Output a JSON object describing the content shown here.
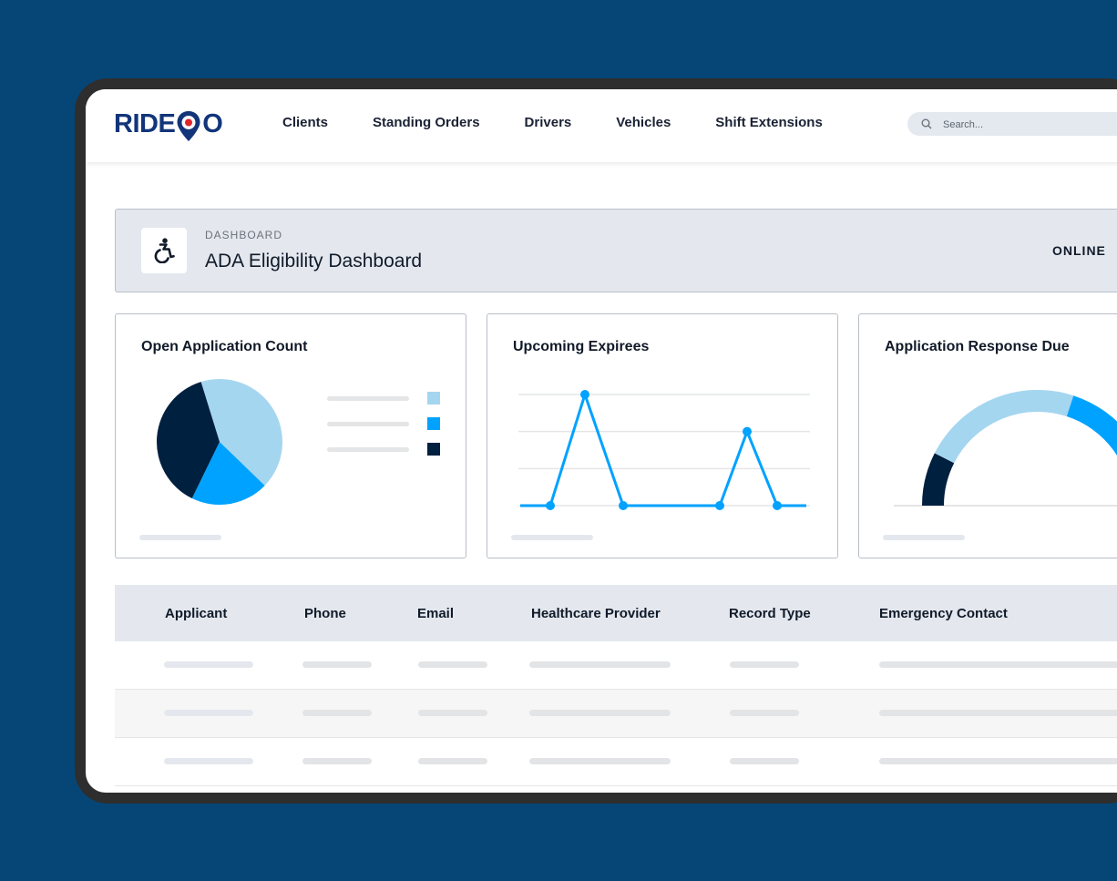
{
  "app": {
    "logo_text_left": "RIDE",
    "logo_text_right": "O"
  },
  "nav": {
    "links": [
      "Clients",
      "Standing Orders",
      "Drivers",
      "Vehicles",
      "Shift Extensions"
    ],
    "search_placeholder": "Search..."
  },
  "header": {
    "kicker": "DASHBOARD",
    "title": "ADA Eligibility Dashboard",
    "status": "ONLINE"
  },
  "cards": {
    "open_applications": {
      "title": "Open Application Count"
    },
    "upcoming_expirees": {
      "title": "Upcoming Expirees"
    },
    "response_due": {
      "title": "Application Response Due"
    }
  },
  "chart_data": [
    {
      "type": "pie",
      "slices": [
        {
          "value": 42,
          "color": "#a5d6f0"
        },
        {
          "value": 20,
          "color": "#00a2ff"
        },
        {
          "value": 38,
          "color": "#00203f"
        }
      ]
    },
    {
      "type": "line",
      "x": [
        1,
        2,
        3,
        4,
        5,
        6,
        7,
        8
      ],
      "values": [
        0,
        0,
        3,
        0,
        0,
        2,
        0,
        0
      ],
      "markers": [
        false,
        true,
        true,
        true,
        true,
        true,
        true,
        false
      ],
      "ylim": [
        0,
        3
      ],
      "grid": true,
      "color": "#00a2ff"
    },
    {
      "type": "gauge",
      "segments": [
        {
          "value": 15,
          "color": "#00203f"
        },
        {
          "value": 45,
          "color": "#a5d6f0"
        },
        {
          "value": 40,
          "color": "#00a2ff"
        }
      ]
    }
  ],
  "table": {
    "columns": [
      "Applicant",
      "Phone",
      "Email",
      "Healthcare Provider",
      "Record Type",
      "Emergency Contact"
    ],
    "row_count": 3
  },
  "colors": {
    "background": "#064677",
    "brand_navy": "#12357a",
    "brand_red": "#e0262c",
    "accent": "#00a2ff",
    "light_accent": "#a5d6f0",
    "dark": "#00203f"
  }
}
